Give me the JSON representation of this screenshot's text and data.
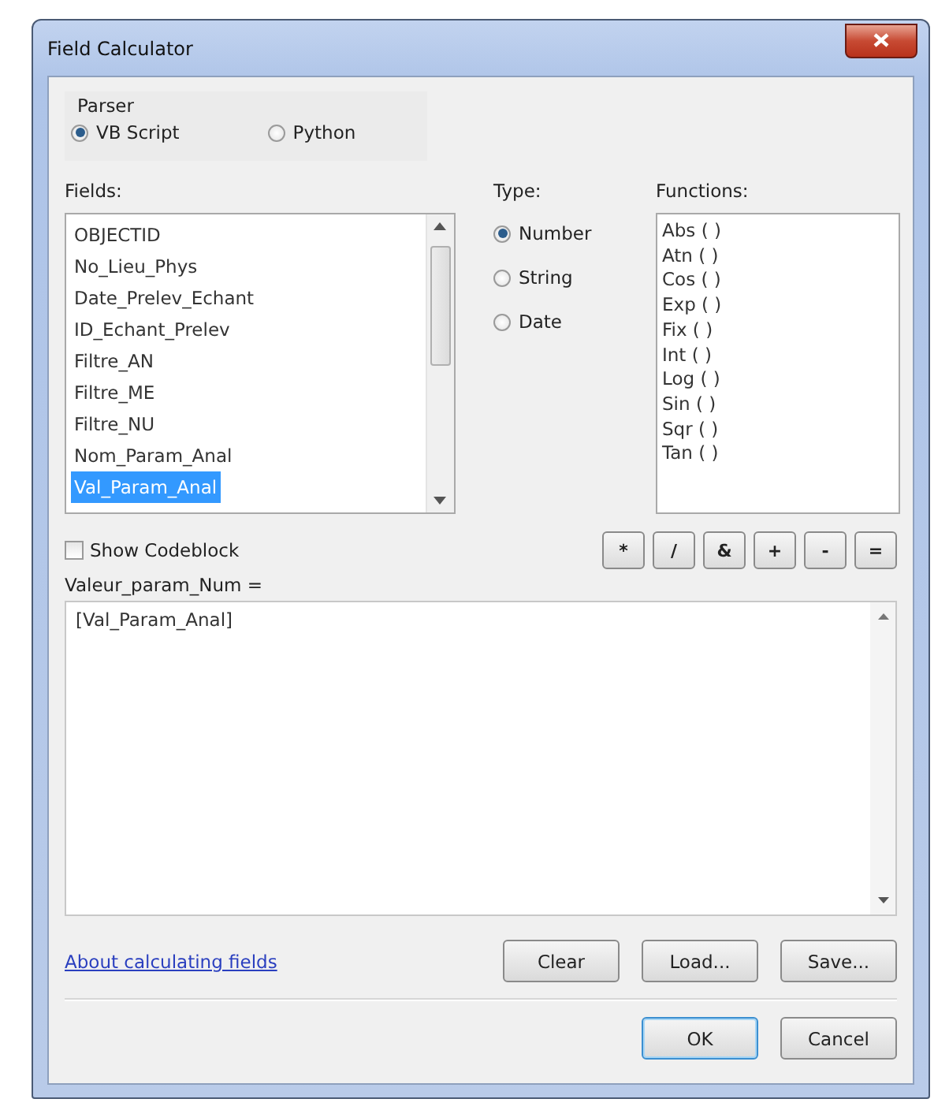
{
  "window": {
    "title": "Field Calculator"
  },
  "parser": {
    "label": "Parser",
    "options": [
      {
        "label": "VB Script",
        "selected": true
      },
      {
        "label": "Python",
        "selected": false
      }
    ]
  },
  "fields": {
    "label": "Fields:",
    "items": [
      {
        "label": "OBJECTID",
        "selected": false
      },
      {
        "label": "No_Lieu_Phys",
        "selected": false
      },
      {
        "label": "Date_Prelev_Echant",
        "selected": false
      },
      {
        "label": "ID_Echant_Prelev",
        "selected": false
      },
      {
        "label": "Filtre_AN",
        "selected": false
      },
      {
        "label": "Filtre_ME",
        "selected": false
      },
      {
        "label": "Filtre_NU",
        "selected": false
      },
      {
        "label": "Nom_Param_Anal",
        "selected": false
      },
      {
        "label": "Val_Param_Anal",
        "selected": true
      }
    ]
  },
  "type": {
    "label": "Type:",
    "options": [
      {
        "label": "Number",
        "selected": true
      },
      {
        "label": "String",
        "selected": false
      },
      {
        "label": "Date",
        "selected": false
      }
    ]
  },
  "functions": {
    "label": "Functions:",
    "items": [
      {
        "label": "Abs ( )",
        "selected": false
      },
      {
        "label": "Atn ( )",
        "selected": false
      },
      {
        "label": "Cos ( )",
        "selected": false
      },
      {
        "label": "Exp ( )",
        "selected": false
      },
      {
        "label": "Fix ( )",
        "selected": false
      },
      {
        "label": "Int ( )",
        "selected": false
      },
      {
        "label": "Log ( )",
        "selected": false
      },
      {
        "label": "Sin ( )",
        "selected": false
      },
      {
        "label": "Sqr ( )",
        "selected": false
      },
      {
        "label": "Tan ( )",
        "selected": false
      }
    ]
  },
  "show_codeblock": {
    "label": "Show Codeblock",
    "checked": false
  },
  "operators": [
    "*",
    "/",
    "&",
    "+",
    "-",
    "="
  ],
  "expression": {
    "label": "Valeur_param_Num =",
    "value": "[Val_Param_Anal]"
  },
  "help_link": "About calculating fields",
  "file_buttons": [
    "Clear",
    "Load...",
    "Save..."
  ],
  "dialog_buttons": [
    {
      "label": "OK",
      "default": true
    },
    {
      "label": "Cancel",
      "default": false
    }
  ]
}
